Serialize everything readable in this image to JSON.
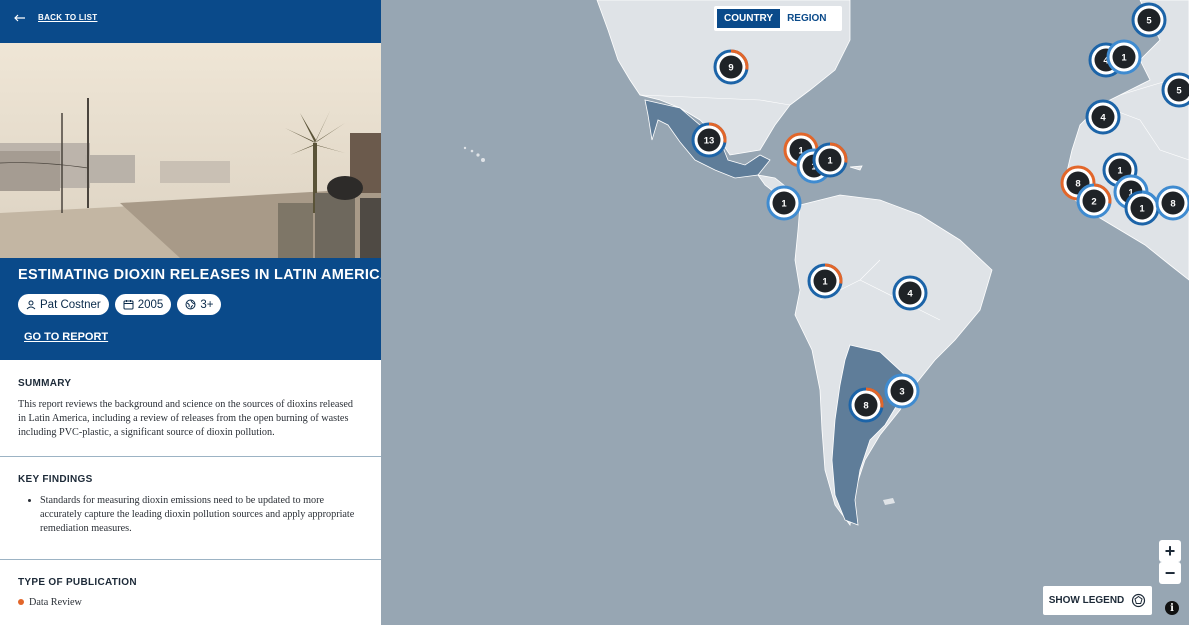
{
  "panel": {
    "back_label": "BACK TO LIST",
    "title": "ESTIMATING DIOXIN RELEASES IN LATIN AMERICA",
    "author": "Pat Costner",
    "year": "2005",
    "region_count": "3+",
    "go_to_report": "GO TO REPORT",
    "summary_heading": "SUMMARY",
    "summary_text": "This report reviews the background and science on the sources of dioxins released in Latin America, including a review of releases from the open burning of wastes including PVC-plastic, a significant source of dioxin pollution.",
    "key_findings_heading": "KEY FINDINGS",
    "key_findings": [
      "Standards for measuring dioxin emissions need to be updated to more accurately capture the leading dioxin pollution sources and apply appropriate remediation measures."
    ],
    "pub_type_heading": "TYPE OF PUBLICATION",
    "pub_type": "Data Review"
  },
  "map": {
    "toggle": {
      "country": "COUNTRY",
      "region": "REGION",
      "selected": "country"
    },
    "zoom_in": "+",
    "zoom_out": "−",
    "show_legend": "SHOW LEGEND",
    "info": "i",
    "colors": {
      "ocean": "#97a6b3",
      "land": "#dfe3e7",
      "highlight": "#5f7d99",
      "marker_dark": "#1f2327",
      "ring_blue": "#1c64a8",
      "ring_light_blue": "#3f8bd0",
      "ring_orange": "#e2662a",
      "ring_yellow": "#e8b62a"
    },
    "clusters": [
      {
        "label": "9"
      },
      {
        "label": "13"
      },
      {
        "label": "1"
      },
      {
        "label": "1"
      },
      {
        "label": "1"
      },
      {
        "label": "1"
      },
      {
        "label": "1"
      },
      {
        "label": "4"
      },
      {
        "label": "3"
      },
      {
        "label": "8"
      },
      {
        "label": "5"
      },
      {
        "label": "4"
      },
      {
        "label": "1"
      },
      {
        "label": "5"
      },
      {
        "label": "4"
      },
      {
        "label": "1"
      },
      {
        "label": "8"
      },
      {
        "label": "2"
      },
      {
        "label": "1"
      },
      {
        "label": "1"
      },
      {
        "label": "8"
      }
    ]
  }
}
